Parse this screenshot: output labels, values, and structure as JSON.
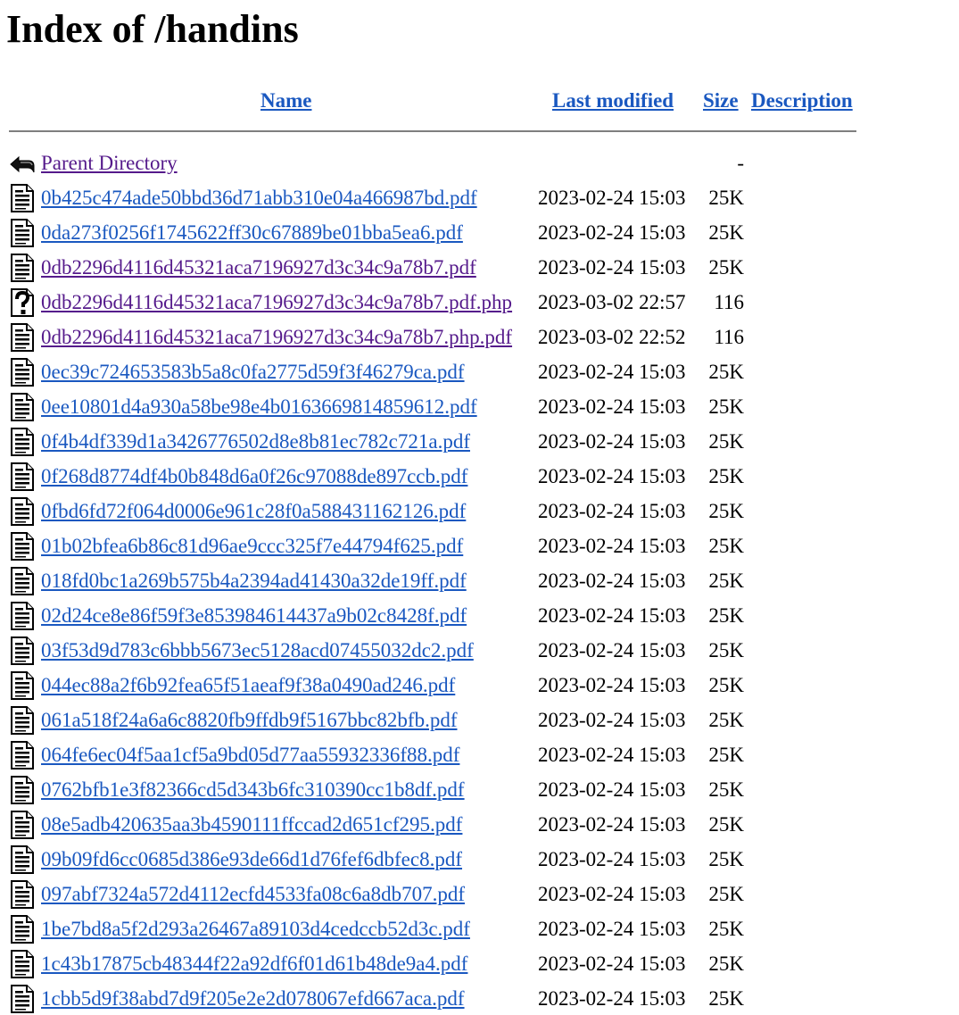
{
  "page": {
    "title": "Index of /handins"
  },
  "columns": {
    "name": "Name",
    "last_modified": "Last modified",
    "size": "Size",
    "description": "Description"
  },
  "icons": {
    "back": "back-arrow-icon",
    "file": "text-file-icon",
    "unknown": "unknown-file-icon"
  },
  "colors": {
    "link": "#1a58c0",
    "visited_link": "#551a8b",
    "rule": "#7f7f7f"
  },
  "entries": [
    {
      "name": "Parent Directory",
      "date": "",
      "size": "-",
      "icon": "back",
      "visited": true
    },
    {
      "name": "0b425c474ade50bbd36d71abb310e04a466987bd.pdf",
      "date": "2023-02-24 15:03",
      "size": "25K",
      "icon": "file",
      "visited": false
    },
    {
      "name": "0da273f0256f1745622ff30c67889be01bba5ea6.pdf",
      "date": "2023-02-24 15:03",
      "size": "25K",
      "icon": "file",
      "visited": false
    },
    {
      "name": "0db2296d4116d45321aca7196927d3c34c9a78b7.pdf",
      "date": "2023-02-24 15:03",
      "size": "25K",
      "icon": "file",
      "visited": true
    },
    {
      "name": "0db2296d4116d45321aca7196927d3c34c9a78b7.pdf.php",
      "date": "2023-03-02 22:57",
      "size": "116",
      "icon": "unknown",
      "visited": true
    },
    {
      "name": "0db2296d4116d45321aca7196927d3c34c9a78b7.php.pdf",
      "date": "2023-03-02 22:52",
      "size": "116",
      "icon": "file",
      "visited": true
    },
    {
      "name": "0ec39c724653583b5a8c0fa2775d59f3f46279ca.pdf",
      "date": "2023-02-24 15:03",
      "size": "25K",
      "icon": "file",
      "visited": false
    },
    {
      "name": "0ee10801d4a930a58be98e4b0163669814859612.pdf",
      "date": "2023-02-24 15:03",
      "size": "25K",
      "icon": "file",
      "visited": false
    },
    {
      "name": "0f4b4df339d1a3426776502d8e8b81ec782c721a.pdf",
      "date": "2023-02-24 15:03",
      "size": "25K",
      "icon": "file",
      "visited": false
    },
    {
      "name": "0f268d8774df4b0b848d6a0f26c97088de897ccb.pdf",
      "date": "2023-02-24 15:03",
      "size": "25K",
      "icon": "file",
      "visited": false
    },
    {
      "name": "0fbd6fd72f064d0006e961c28f0a588431162126.pdf",
      "date": "2023-02-24 15:03",
      "size": "25K",
      "icon": "file",
      "visited": false
    },
    {
      "name": "01b02bfea6b86c81d96ae9ccc325f7e44794f625.pdf",
      "date": "2023-02-24 15:03",
      "size": "25K",
      "icon": "file",
      "visited": false
    },
    {
      "name": "018fd0bc1a269b575b4a2394ad41430a32de19ff.pdf",
      "date": "2023-02-24 15:03",
      "size": "25K",
      "icon": "file",
      "visited": false
    },
    {
      "name": "02d24ce8e86f59f3e853984614437a9b02c8428f.pdf",
      "date": "2023-02-24 15:03",
      "size": "25K",
      "icon": "file",
      "visited": false
    },
    {
      "name": "03f53d9d783c6bbb5673ec5128acd07455032dc2.pdf",
      "date": "2023-02-24 15:03",
      "size": "25K",
      "icon": "file",
      "visited": false
    },
    {
      "name": "044ec88a2f6b92fea65f51aeaf9f38a0490ad246.pdf",
      "date": "2023-02-24 15:03",
      "size": "25K",
      "icon": "file",
      "visited": false
    },
    {
      "name": "061a518f24a6a6c8820fb9ffdb9f5167bbc82bfb.pdf",
      "date": "2023-02-24 15:03",
      "size": "25K",
      "icon": "file",
      "visited": false
    },
    {
      "name": "064fe6ec04f5aa1cf5a9bd05d77aa55932336f88.pdf",
      "date": "2023-02-24 15:03",
      "size": "25K",
      "icon": "file",
      "visited": false
    },
    {
      "name": "0762bfb1e3f82366cd5d343b6fc310390cc1b8df.pdf",
      "date": "2023-02-24 15:03",
      "size": "25K",
      "icon": "file",
      "visited": false
    },
    {
      "name": "08e5adb420635aa3b4590111ffccad2d651cf295.pdf",
      "date": "2023-02-24 15:03",
      "size": "25K",
      "icon": "file",
      "visited": false
    },
    {
      "name": "09b09fd6cc0685d386e93de66d1d76fef6dbfec8.pdf",
      "date": "2023-02-24 15:03",
      "size": "25K",
      "icon": "file",
      "visited": false
    },
    {
      "name": "097abf7324a572d4112ecfd4533fa08c6a8db707.pdf",
      "date": "2023-02-24 15:03",
      "size": "25K",
      "icon": "file",
      "visited": false
    },
    {
      "name": "1be7bd8a5f2d293a26467a89103d4cedccb52d3c.pdf",
      "date": "2023-02-24 15:03",
      "size": "25K",
      "icon": "file",
      "visited": false
    },
    {
      "name": "1c43b17875cb48344f22a92df6f01d61b48de9a4.pdf",
      "date": "2023-02-24 15:03",
      "size": "25K",
      "icon": "file",
      "visited": false
    },
    {
      "name": "1cbb5d9f38abd7d9f205e2e2d078067efd667aca.pdf",
      "date": "2023-02-24 15:03",
      "size": "25K",
      "icon": "file",
      "visited": false
    }
  ]
}
